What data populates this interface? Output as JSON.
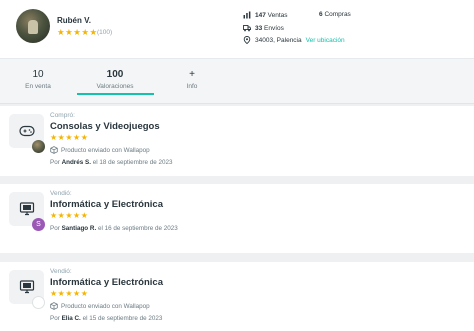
{
  "profile": {
    "name": "Rubén V.",
    "stars": "★★★★★",
    "review_count": "(100)",
    "sales_count": "147",
    "sales_label": "Ventas",
    "purchases_count": "6",
    "purchases_label": "Compras",
    "shipments_count": "33",
    "shipments_label": "Envíos",
    "location": "34003, Palencia",
    "location_link": "Ver ubicación"
  },
  "tabs": [
    {
      "value": "10",
      "label": "En venta"
    },
    {
      "value": "100",
      "label": "Valoraciones"
    },
    {
      "value": "+",
      "label": "Info"
    }
  ],
  "reviews": [
    {
      "kind": "Compró:",
      "category": "Consolas y Videojuegos",
      "stars": "★★★★★",
      "shipping": "Producto enviado con Wallapop",
      "by_label": "Por",
      "author": "Andrés S.",
      "date": "el 18 de septiembre de 2023",
      "category_icon": "gamepad-icon"
    },
    {
      "kind": "Vendió:",
      "category": "Informática y Electrónica",
      "stars": "★★★★★",
      "by_label": "Por",
      "author": "Santiago R.",
      "date": "el 16 de septiembre de 2023",
      "badge_letter": "S",
      "category_icon": "computer-icon"
    },
    {
      "kind": "Vendió:",
      "category": "Informática y Electrónica",
      "stars": "★★★★★",
      "shipping": "Producto enviado con Wallapop",
      "by_label": "Por",
      "author": "Elia C.",
      "date": "el 15 de septiembre de 2023",
      "category_icon": "computer-icon"
    }
  ],
  "colors": {
    "accent": "#13c1ac",
    "star": "#f5b400",
    "text": "#29363d",
    "muted": "#90a4ae"
  }
}
